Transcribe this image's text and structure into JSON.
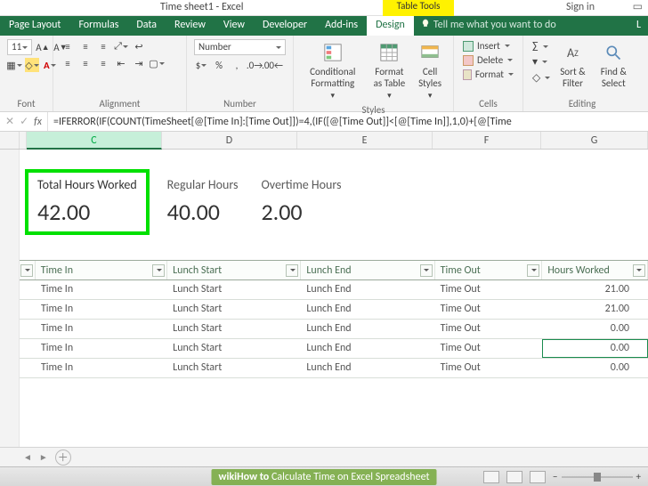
{
  "titlebar": {
    "filename": "Time sheet1 - Excel",
    "tabletools": "Table Tools",
    "signin": "Sign in"
  },
  "ribbon": {
    "tabs": [
      "Page Layout",
      "Formulas",
      "Data",
      "Review",
      "View",
      "Developer",
      "Add-ins",
      "Design"
    ],
    "active_tab": "Design",
    "tellme": "Tell me what you want to do",
    "font": {
      "size": "11",
      "group": "Font"
    },
    "alignment": {
      "group": "Alignment",
      "wrap": "Wrap Text",
      "merge": "Merge & Center"
    },
    "number": {
      "group": "Number",
      "format": "Number"
    },
    "styles": {
      "group": "Styles",
      "cond": "Conditional Formatting",
      "table": "Format as Table",
      "cell": "Cell Styles"
    },
    "cells": {
      "group": "Cells",
      "insert": "Insert",
      "delete": "Delete",
      "format": "Format"
    },
    "editing": {
      "group": "Editing",
      "sort": "Sort & Filter",
      "find": "Find & Select"
    }
  },
  "formula_bar": {
    "fx": "fx",
    "formula": "=IFERROR(IF(COUNT(TimeSheet[@[Time In]:[Time Out]])=4,(IF([@[Time Out]]<[@[Time In]],1,0)+[@[Time"
  },
  "columns": {
    "C": "C",
    "D": "D",
    "E": "E",
    "F": "F",
    "G": "G"
  },
  "summary": {
    "total_label": "Total Hours Worked",
    "total_value": "42.00",
    "reg_label": "Regular Hours",
    "reg_value": "40.00",
    "ot_label": "Overtime Hours",
    "ot_value": "2.00"
  },
  "table": {
    "headers": {
      "time_in": "Time In",
      "lunch_start": "Lunch Start",
      "lunch_end": "Lunch End",
      "time_out": "Time Out",
      "hours": "Hours Worked"
    },
    "rows": [
      {
        "time_in": "Time In",
        "lunch_start": "Lunch Start",
        "lunch_end": "Lunch End",
        "time_out": "Time Out",
        "hours": "21.00"
      },
      {
        "time_in": "Time In",
        "lunch_start": "Lunch Start",
        "lunch_end": "Lunch End",
        "time_out": "Time Out",
        "hours": "21.00"
      },
      {
        "time_in": "Time In",
        "lunch_start": "Lunch Start",
        "lunch_end": "Lunch End",
        "time_out": "Time Out",
        "hours": "0.00"
      },
      {
        "time_in": "Time In",
        "lunch_start": "Lunch Start",
        "lunch_end": "Lunch End",
        "time_out": "Time Out",
        "hours": "0.00"
      },
      {
        "time_in": "Time In",
        "lunch_start": "Lunch Start",
        "lunch_end": "Lunch End",
        "time_out": "Time Out",
        "hours": "0.00"
      }
    ]
  },
  "statusbar": {
    "watermark_prefix": "wikiHow to ",
    "watermark": "Calculate Time on Excel Spreadsheet"
  },
  "selected": {
    "col": "G",
    "row_index": 3
  }
}
